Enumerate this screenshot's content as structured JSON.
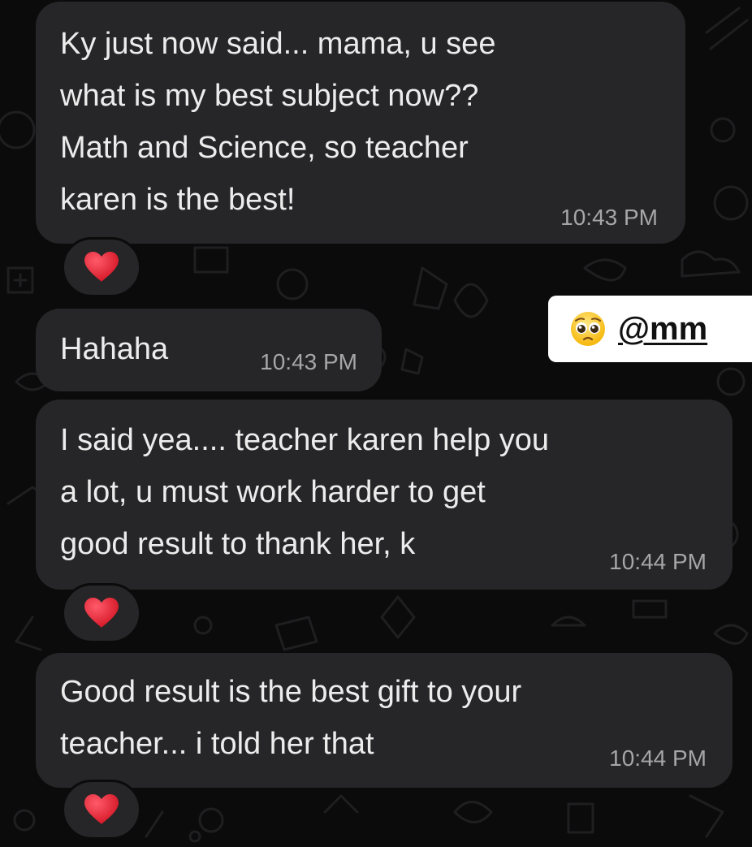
{
  "colors": {
    "background": "#0b0b0b",
    "bubble": "#262628",
    "message_text": "#ececec",
    "timestamp": "#a6a6a8",
    "heart": "#e0182d",
    "sticker_background": "#ffffff"
  },
  "messages": [
    {
      "text": "Ky just now said... mama, u see\nwhat is my best subject now??\nMath and Science, so teacher\nkaren is the best!",
      "time": "10:43 PM",
      "reaction": "heart-icon"
    },
    {
      "text": "Hahaha",
      "time": "10:43 PM",
      "reaction": null
    },
    {
      "text": "I said yea.... teacher karen help you\na lot, u must work harder to get\ngood result to thank her, k",
      "time": "10:44 PM",
      "reaction": "heart-icon"
    },
    {
      "text": "Good result is the best gift to your\nteacher... i told her that",
      "time": "10:44 PM",
      "reaction": "heart-icon"
    }
  ],
  "mention_sticker": {
    "emoji": "pleading-face-icon",
    "handle": "@mm"
  }
}
